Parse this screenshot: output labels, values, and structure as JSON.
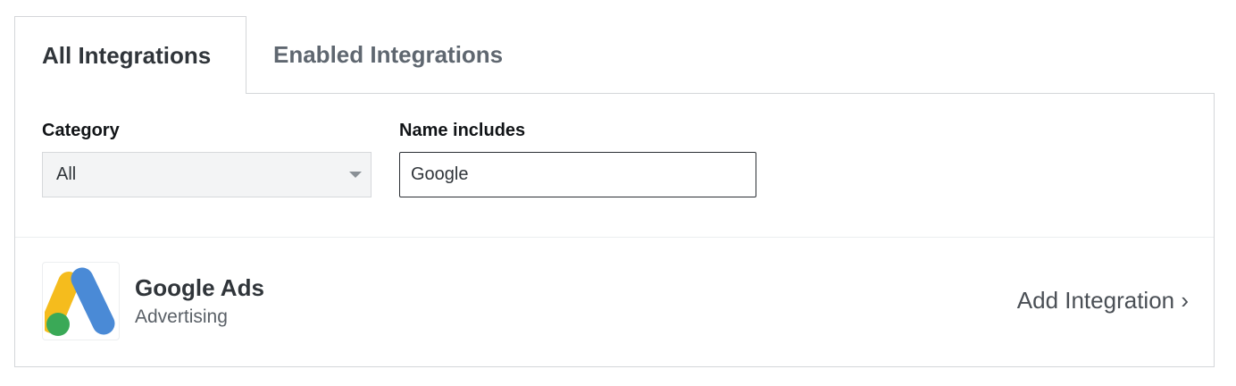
{
  "tabs": [
    {
      "label": "All Integrations",
      "active": true
    },
    {
      "label": "Enabled Integrations",
      "active": false
    }
  ],
  "filters": {
    "category": {
      "label": "Category",
      "value": "All"
    },
    "name": {
      "label": "Name includes",
      "value": "Google"
    }
  },
  "integrations": [
    {
      "name": "Google Ads",
      "category": "Advertising",
      "action_label": "Add Integration ›",
      "icon": "google-ads-logo",
      "colors": {
        "blue": "#4a8ad6",
        "yellow": "#f5bc1d",
        "green": "#3aa957"
      }
    }
  ]
}
